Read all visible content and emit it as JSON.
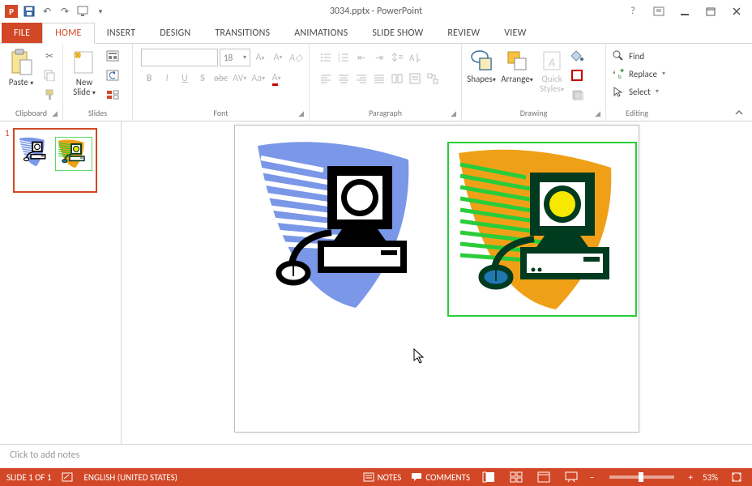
{
  "app_icon": "P",
  "title": "3034.pptx - PowerPoint",
  "tabs": {
    "file": "FILE",
    "home": "HOME",
    "insert": "INSERT",
    "design": "DESIGN",
    "transitions": "TRANSITIONS",
    "animations": "ANIMATIONS",
    "slideshow": "SLIDE SHOW",
    "review": "REVIEW",
    "view": "VIEW"
  },
  "groups": {
    "clipboard": {
      "label": "Clipboard",
      "paste": "Paste"
    },
    "slides": {
      "label": "Slides",
      "newslide": "New\nSlide"
    },
    "font": {
      "label": "Font",
      "size": "18"
    },
    "paragraph": {
      "label": "Paragraph"
    },
    "drawing": {
      "label": "Drawing",
      "shapes": "Shapes",
      "arrange": "Arrange",
      "quick": "Quick\nStyles"
    },
    "editing": {
      "label": "Editing",
      "find": "Find",
      "replace": "Replace",
      "select": "Select"
    }
  },
  "thumb": {
    "num": "1"
  },
  "notes_placeholder": "Click to add notes",
  "status": {
    "slidecount": "SLIDE 1 OF 1",
    "language": "ENGLISH (UNITED STATES)",
    "notes": "NOTES",
    "comments": "COMMENTS",
    "zoom": "53%"
  }
}
